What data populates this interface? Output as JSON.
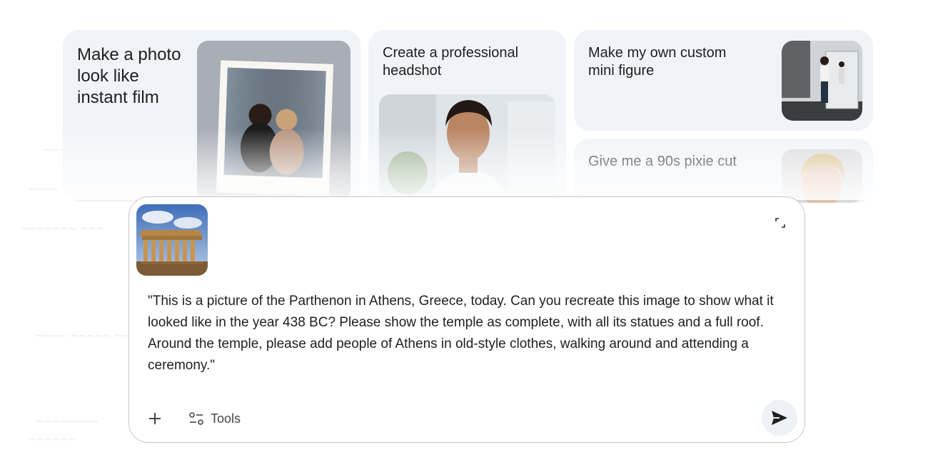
{
  "cards": {
    "instant_film": {
      "title": "Make a photo look like instant film"
    },
    "headshot": {
      "title": "Create a professional headshot"
    },
    "mini_figure": {
      "title": "Make my own custom mini figure"
    },
    "pixie_cut": {
      "title": "Give me a 90s pixie cut"
    }
  },
  "composer": {
    "attachment_icon": "parthenon-thumbnail",
    "prompt_text": "\"This is a picture of the Parthenon in Athens, Greece, today. Can you recreate this image to show what it looked like in the year 438 BC? Please show the temple as complete, with all its statues and a full roof. Around the temple, please add people of Athens in old-style clothes, walking around and attending a ceremony.\"",
    "tools_label": "Tools",
    "icons": {
      "expand": "expand-icon",
      "add": "plus-icon",
      "tools": "tools-icon",
      "send": "send-icon"
    }
  },
  "colors": {
    "card_bg": "#f0f3f8",
    "composer_border": "#c4c7cc",
    "send_bg": "#eef1f6"
  }
}
